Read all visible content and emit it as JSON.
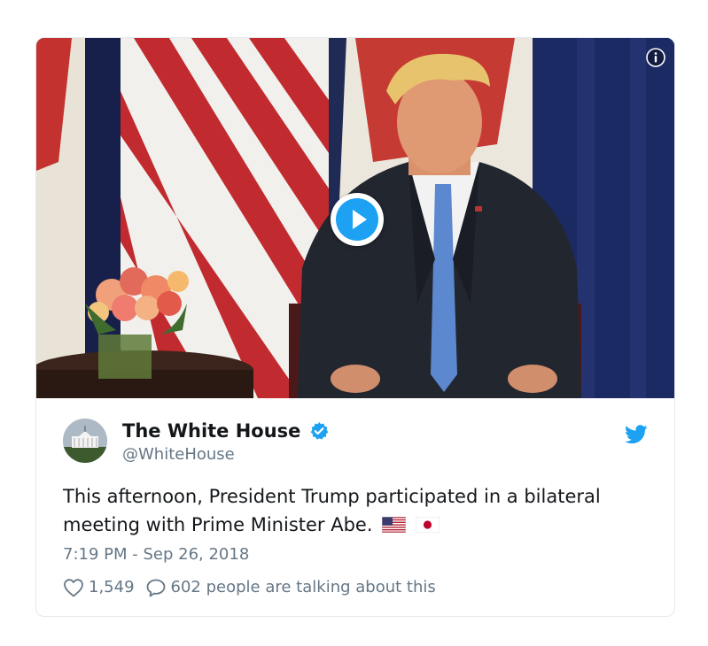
{
  "tweet": {
    "display_name": "The White House",
    "handle": "@WhiteHouse",
    "verified": true,
    "text": "This afternoon, President Trump participated in a bilateral meeting with Prime Minister Abe.",
    "flags": [
      "us-flag",
      "japan-flag"
    ],
    "timestamp": "7:19 PM - Sep 26, 2018",
    "likes": "1,549",
    "talking": "602 people are talking about this"
  },
  "media": {
    "type": "video",
    "play_icon": "play-icon",
    "info_icon": "info-icon"
  },
  "icons": {
    "brand": "twitter-bird-icon",
    "verified": "verified-badge-icon",
    "like": "heart-icon",
    "reply": "speech-bubble-icon"
  },
  "colors": {
    "twitter_blue": "#1da1f2",
    "text_primary": "#14171a",
    "text_secondary": "#657786",
    "border": "#e1e8ed"
  }
}
